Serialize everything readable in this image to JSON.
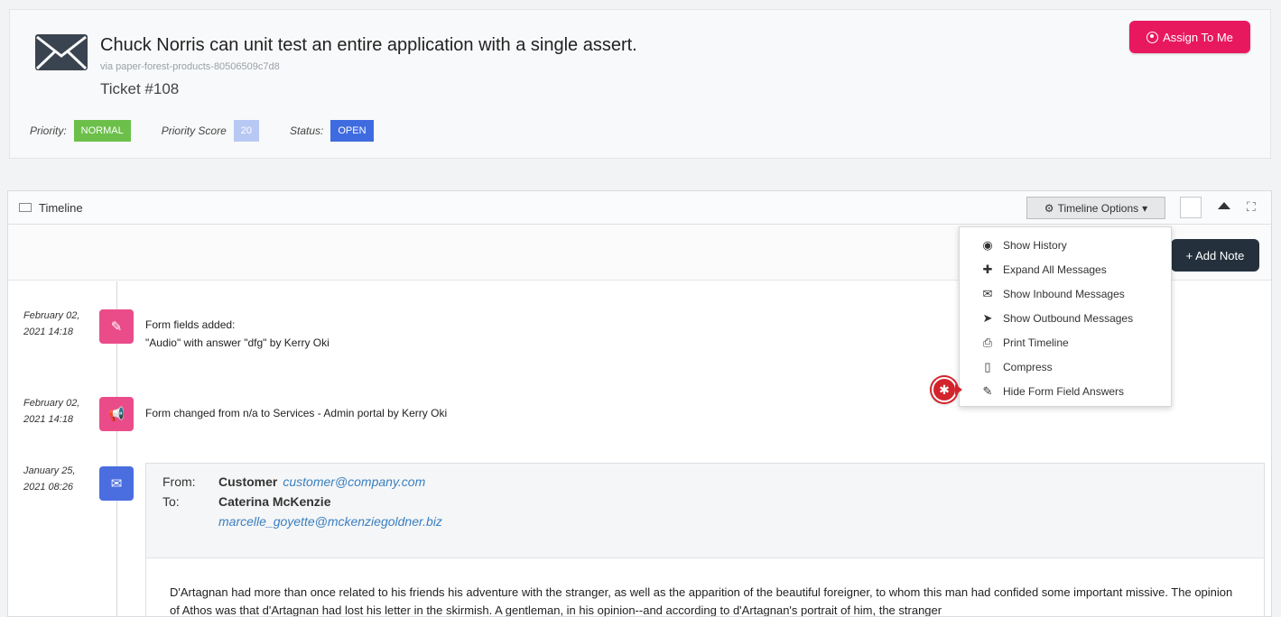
{
  "ticket": {
    "title": "Chuck Norris can unit test an entire application with a single assert.",
    "via": "via paper-forest-products-80506509c7d8",
    "number": "Ticket #108",
    "assign_label": "Assign To Me",
    "priority_label": "Priority:",
    "priority_value": "NORMAL",
    "score_label": "Priority Score",
    "score_value": "20",
    "status_label": "Status:",
    "status_value": "OPEN"
  },
  "timeline": {
    "title": "Timeline",
    "options_label": "Timeline Options",
    "add_note_label": "+ Add Note"
  },
  "menu": {
    "items": [
      {
        "label": "Show History",
        "icon": "eye-icon"
      },
      {
        "label": "Expand All Messages",
        "icon": "plus-icon"
      },
      {
        "label": "Show Inbound Messages",
        "icon": "envelope-icon"
      },
      {
        "label": "Show Outbound Messages",
        "icon": "send-icon"
      },
      {
        "label": "Print Timeline",
        "icon": "print-icon"
      },
      {
        "label": "Compress",
        "icon": "compress-icon"
      },
      {
        "label": "Hide Form Field Answers",
        "icon": "edit-icon"
      }
    ]
  },
  "entries": [
    {
      "date": "February 02,",
      "time": "2021 14:18",
      "line1": "Form fields added:",
      "line2": "\"Audio\" with answer \"dfg\" by Kerry Oki",
      "icon": "edit-icon"
    },
    {
      "date": "February 02,",
      "time": "2021 14:18",
      "line1": "Form changed from n/a to Services - Admin portal by Kerry Oki",
      "icon": "megaphone-icon"
    },
    {
      "date": "January 25,",
      "time": "2021 08:26",
      "icon": "envelope-icon"
    }
  ],
  "message": {
    "from_label": "From:",
    "from_name": "Customer",
    "from_email": "customer@company.com",
    "to_label": "To:",
    "to_name": "Caterina McKenzie",
    "to_email": "marcelle_goyette@mckenziegoldner.biz",
    "body": "D'Artagnan had more than once related to his friends his adventure with the stranger, as well as the apparition of the beautiful foreigner, to whom this man had confided some important missive. The opinion of Athos was that d'Artagnan had lost his letter in the skirmish. A gentleman, in his opinion--and according to d'Artagnan's portrait of him, the stranger"
  }
}
